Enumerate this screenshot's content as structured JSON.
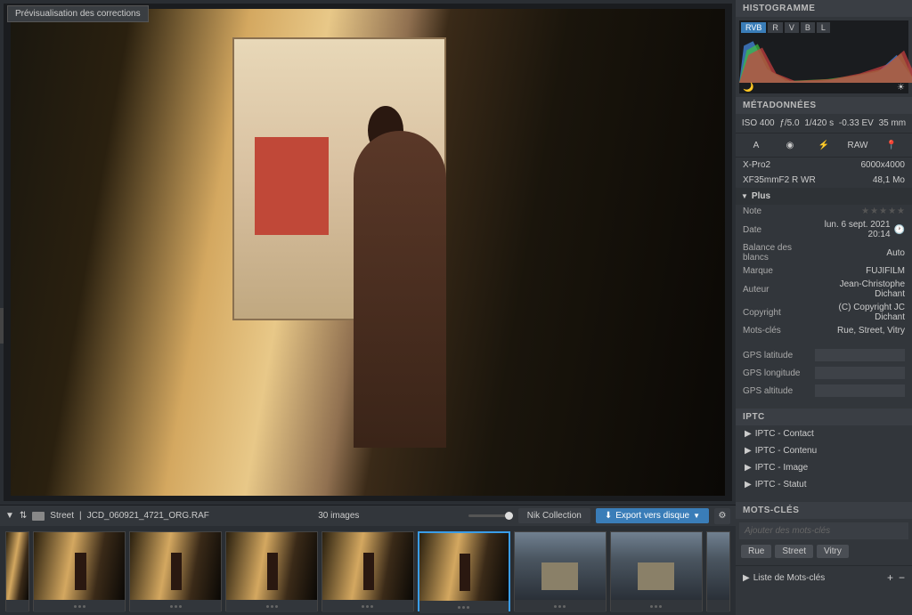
{
  "tooltip": "Prévisualisation des corrections",
  "toolbar": {
    "folder": "Street",
    "filename": "JCD_060921_4721_ORG.RAF",
    "count": "30 images",
    "nik": "Nik Collection",
    "export": "Export vers disque"
  },
  "histo": {
    "title": "HISTOGRAMME",
    "tabs": [
      "RVB",
      "R",
      "V",
      "B",
      "L"
    ]
  },
  "exif": {
    "iso": "ISO 400",
    "aperture": "ƒ/5.0",
    "shutter": "1/420 s",
    "ev": "-0.33 EV",
    "focal": "35 mm",
    "mode": "A",
    "format": "RAW",
    "camera": "X-Pro2",
    "resolution": "6000x4000",
    "lens": "XF35mmF2 R WR",
    "size": "48,1 Mo"
  },
  "meta": {
    "title": "MÉTADONNÉES",
    "plus": "Plus",
    "note_label": "Note",
    "date_label": "Date",
    "date_value": "lun. 6 sept. 2021 20:14",
    "wb_label": "Balance des blancs",
    "wb_value": "Auto",
    "brand_label": "Marque",
    "brand_value": "FUJIFILM",
    "author_label": "Auteur",
    "author_value": "Jean-Christophe Dichant",
    "copyright_label": "Copyright",
    "copyright_value": "(C) Copyright JC Dichant",
    "keywords_label": "Mots-clés",
    "keywords_value": "Rue, Street, Vitry",
    "gps_lat": "GPS latitude",
    "gps_lon": "GPS longitude",
    "gps_alt": "GPS altitude"
  },
  "iptc": {
    "title": "IPTC",
    "items": [
      "IPTC - Contact",
      "IPTC - Contenu",
      "IPTC - Image",
      "IPTC - Statut"
    ]
  },
  "keywords": {
    "title": "MOTS-CLÉS",
    "placeholder": "Ajouter des mots-clés",
    "tags": [
      "Rue",
      "Street",
      "Vitry"
    ],
    "list_label": "Liste de Mots-clés"
  }
}
